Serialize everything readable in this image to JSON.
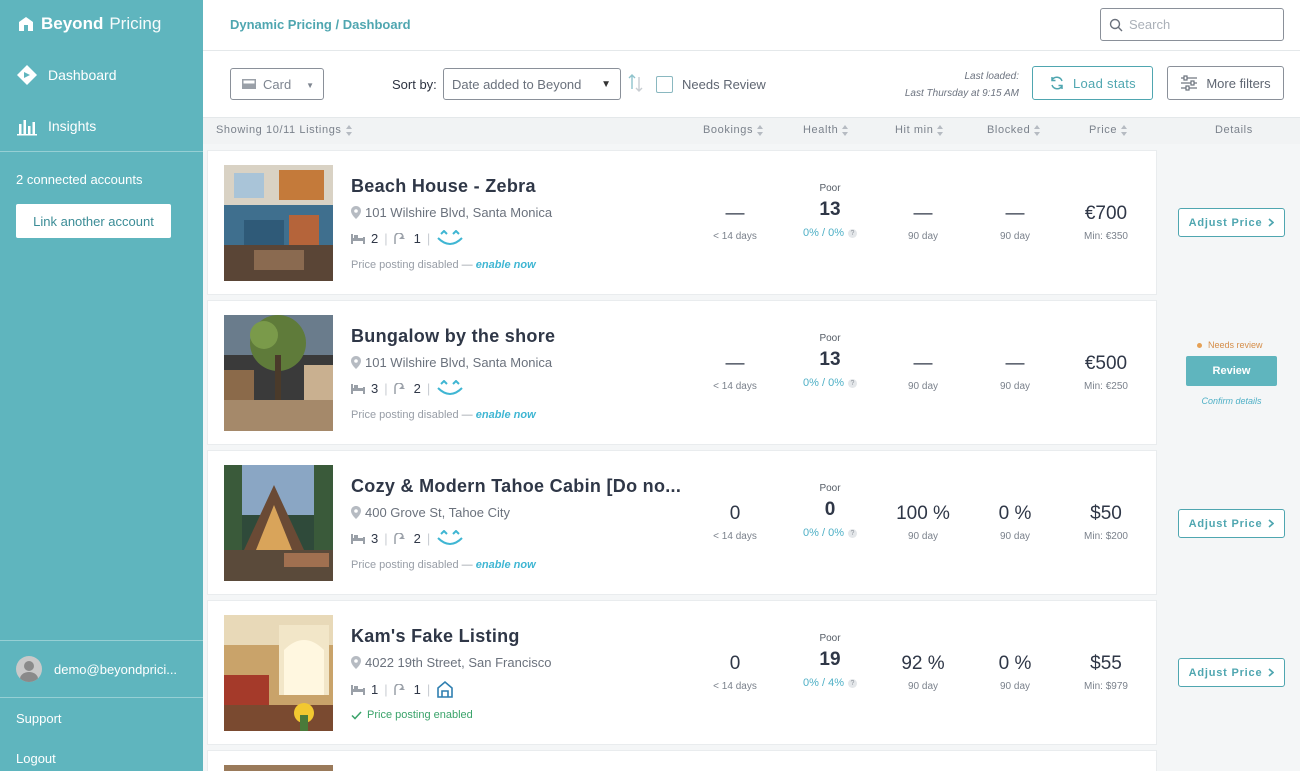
{
  "brand": {
    "bold": "Beyond",
    "light": "Pricing"
  },
  "sidebar": {
    "items": [
      {
        "label": "Dashboard",
        "icon": "diamond-logo-icon"
      },
      {
        "label": "Insights",
        "icon": "bar-chart-icon"
      }
    ],
    "connected_accounts": "2 connected accounts",
    "link_button": "Link another account",
    "user_email": "demo@beyondprici...",
    "support": "Support",
    "logout": "Logout"
  },
  "header": {
    "breadcrumb": "Dynamic Pricing / Dashboard",
    "search_placeholder": "Search"
  },
  "toolbar": {
    "view_select": "Card",
    "sort_label": "Sort by:",
    "sort_value": "Date added to Beyond",
    "needs_review": "Needs Review",
    "last_loaded_label": "Last loaded:",
    "last_loaded_value": "Last Thursday at 9:15 AM",
    "load_stats": "Load stats",
    "more_filters": "More filters"
  },
  "columns": {
    "showing": "Showing 10/11 Listings",
    "bookings": "Bookings",
    "health": "Health",
    "hit_min": "Hit min",
    "blocked": "Blocked",
    "price": "Price",
    "details": "Details"
  },
  "listings": [
    {
      "name": "Beach House - Zebra",
      "address": "101 Wilshire Blvd, Santa Monica",
      "beds": "2",
      "baths": "1",
      "posting_text": "Price posting disabled — ",
      "posting_link": "enable now",
      "bookings": "—",
      "bookings_sub": "< 14 days",
      "health_label": "Poor",
      "health": "13",
      "health_pct": "0% / 0%",
      "hit_min": "—",
      "hit_min_sub": "90 day",
      "blocked": "—",
      "blocked_sub": "90 day",
      "price": "€700",
      "price_min": "Min: €350",
      "action": "Adjust Price"
    },
    {
      "name": "Bungalow by the shore",
      "address": "101 Wilshire Blvd, Santa Monica",
      "beds": "3",
      "baths": "2",
      "posting_text": "Price posting disabled — ",
      "posting_link": "enable now",
      "bookings": "—",
      "bookings_sub": "< 14 days",
      "health_label": "Poor",
      "health": "13",
      "health_pct": "0% / 0%",
      "hit_min": "—",
      "hit_min_sub": "90 day",
      "blocked": "—",
      "blocked_sub": "90 day",
      "price": "€500",
      "price_min": "Min: €250",
      "needs_review": "Needs review",
      "review": "Review",
      "confirm": "Confirm details"
    },
    {
      "name": "Cozy & Modern Tahoe Cabin [Do no...",
      "address": "400 Grove St, Tahoe City",
      "beds": "3",
      "baths": "2",
      "posting_text": "Price posting disabled — ",
      "posting_link": "enable now",
      "bookings": "0",
      "bookings_sub": "< 14 days",
      "health_label": "Poor",
      "health": "0",
      "health_pct": "0% / 0%",
      "hit_min": "100 %",
      "hit_min_sub": "90 day",
      "blocked": "0 %",
      "blocked_sub": "90 day",
      "price": "$50",
      "price_min": "Min: $200",
      "action": "Adjust Price"
    },
    {
      "name": "Kam's Fake Listing",
      "address": "4022 19th Street, San Francisco",
      "beds": "1",
      "baths": "1",
      "posting_enabled": "Price posting enabled",
      "bookings": "0",
      "bookings_sub": "< 14 days",
      "health_label": "Poor",
      "health": "19",
      "health_pct": "0% / 4%",
      "hit_min": "92 %",
      "hit_min_sub": "90 day",
      "blocked": "0 %",
      "blocked_sub": "90 day",
      "price": "$55",
      "price_min": "Min: $979",
      "action": "Adjust Price"
    }
  ],
  "colors": {
    "sidebar": "#5fb5be",
    "accent": "#4fa6b0",
    "link": "#3fb6d3",
    "warn": "#e5a055",
    "ok": "#3aa36a"
  }
}
